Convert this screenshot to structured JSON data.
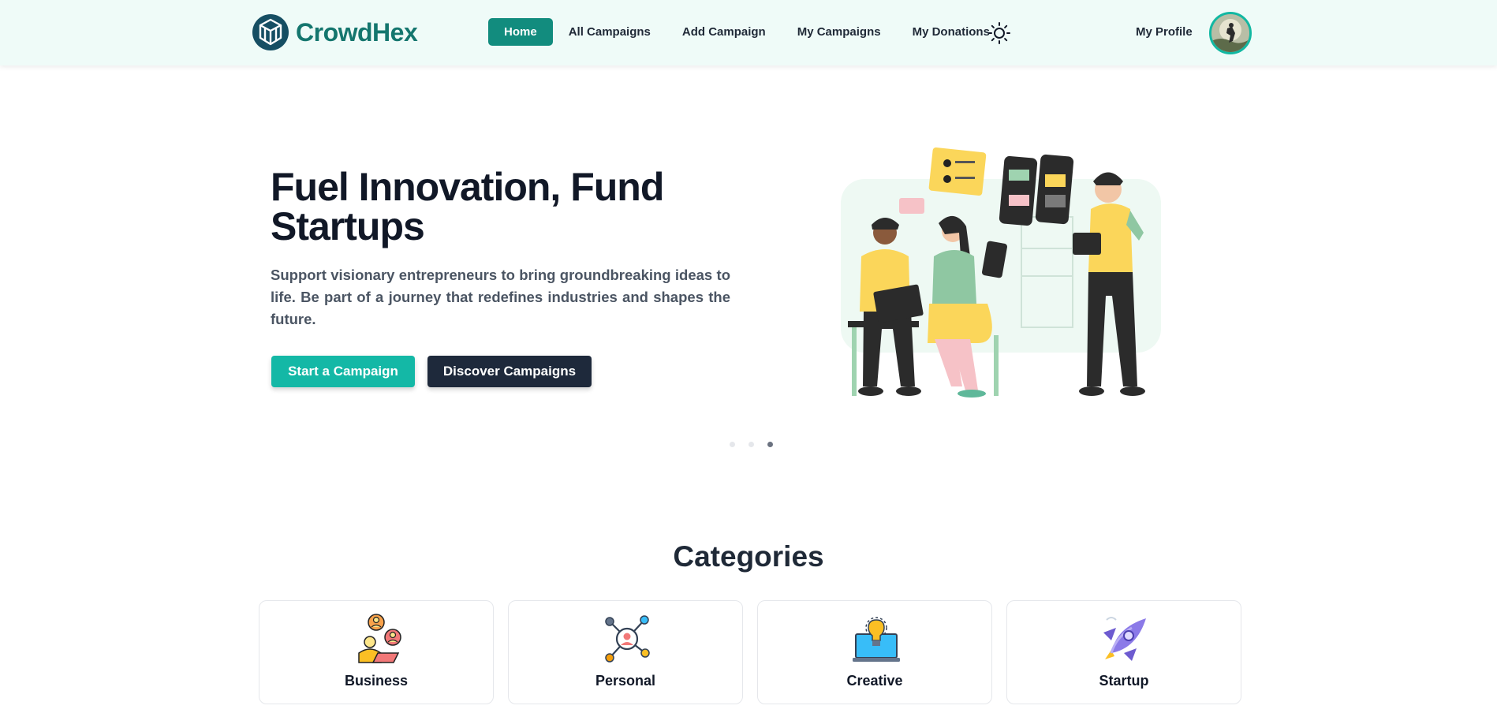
{
  "brand": {
    "name": "CrowdHex",
    "color": "#14766e"
  },
  "nav": {
    "items": [
      {
        "label": "Home",
        "active": true
      },
      {
        "label": "All Campaigns",
        "active": false
      },
      {
        "label": "Add Campaign",
        "active": false
      },
      {
        "label": "My Campaigns",
        "active": false
      },
      {
        "label": "My Donations",
        "active": false
      }
    ],
    "theme_icon": "sun-icon",
    "profile_label": "My Profile"
  },
  "hero": {
    "title": "Fuel Innovation, Fund Startups",
    "description": "Support visionary entrepreneurs to bring groundbreaking ideas to life. Be part of a journey that redefines industries and shapes the future.",
    "primary_button": "Start a Campaign",
    "secondary_button": "Discover Campaigns",
    "slides": 3,
    "active_slide": 3
  },
  "categories": {
    "title": "Categories",
    "items": [
      {
        "label": "Business",
        "icon": "business-people-icon"
      },
      {
        "label": "Personal",
        "icon": "personal-network-icon"
      },
      {
        "label": "Creative",
        "icon": "lightbulb-laptop-icon"
      },
      {
        "label": "Startup",
        "icon": "rocket-icon"
      }
    ]
  },
  "colors": {
    "accent": "#128c7e",
    "primary_button": "#14b8a6",
    "dark_button": "#1e293b",
    "navbar_bg": "#effbf8"
  }
}
